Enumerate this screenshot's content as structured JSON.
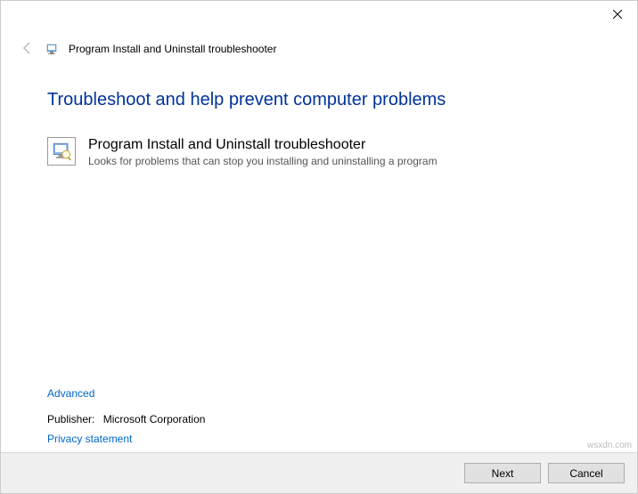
{
  "header": {
    "title": "Program Install and Uninstall troubleshooter"
  },
  "main": {
    "heading": "Troubleshoot and help prevent computer problems",
    "item_title": "Program Install and Uninstall troubleshooter",
    "item_desc": "Looks for problems that can stop you installing and uninstalling a program"
  },
  "links": {
    "advanced": "Advanced",
    "privacy": "Privacy statement"
  },
  "publisher": {
    "label": "Publisher:",
    "value": "Microsoft Corporation"
  },
  "buttons": {
    "next": "Next",
    "cancel": "Cancel"
  },
  "watermark": "wsxdn.com"
}
